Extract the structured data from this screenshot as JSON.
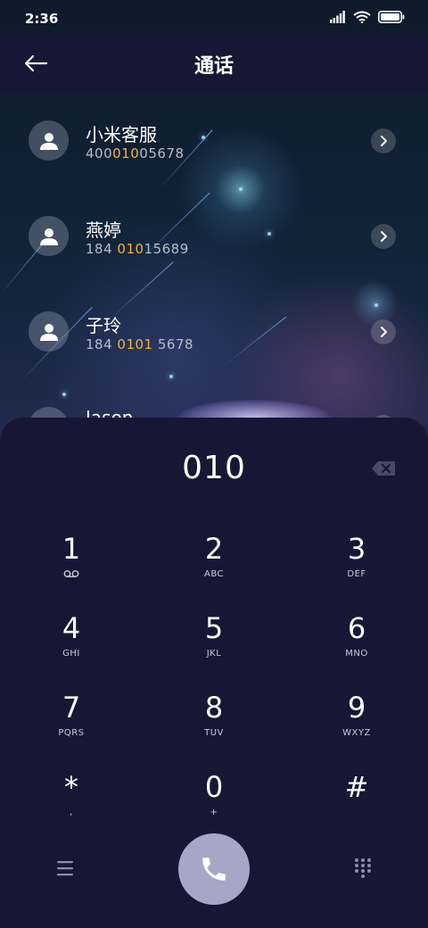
{
  "status": {
    "time": "2:36"
  },
  "header": {
    "title": "通话"
  },
  "contacts": [
    {
      "name": "小米客服",
      "num_pre": "400",
      "num_hl": "010",
      "num_post": "05678"
    },
    {
      "name": "燕婷",
      "num_pre": "184 ",
      "num_hl": "010",
      "num_post": "15689"
    },
    {
      "name": "子玲",
      "num_pre": "184 ",
      "num_hl": "0101",
      "num_post": " 5678"
    },
    {
      "name": "Jason"
    }
  ],
  "dialer": {
    "display": "010",
    "keys": [
      {
        "digit": "1",
        "sub": ""
      },
      {
        "digit": "2",
        "sub": "ABC"
      },
      {
        "digit": "3",
        "sub": "DEF"
      },
      {
        "digit": "4",
        "sub": "GHI"
      },
      {
        "digit": "5",
        "sub": "JKL"
      },
      {
        "digit": "6",
        "sub": "MNO"
      },
      {
        "digit": "7",
        "sub": "PQRS"
      },
      {
        "digit": "8",
        "sub": "TUV"
      },
      {
        "digit": "9",
        "sub": "WXYZ"
      },
      {
        "digit": "*",
        "sub": ","
      },
      {
        "digit": "0",
        "sub": "+"
      },
      {
        "digit": "#",
        "sub": ""
      }
    ]
  },
  "icons": {
    "back": "arrow-left-icon",
    "contact_avatar": "person-icon",
    "contact_detail": "chevron-right-icon",
    "backspace": "backspace-icon",
    "voicemail": "voicemail-icon",
    "menu": "menu-icon",
    "call": "phone-icon",
    "keypad": "dialpad-icon"
  },
  "colors": {
    "background": "#171634",
    "highlight": "#f3b33d",
    "call_button": "#a8a6c6"
  }
}
